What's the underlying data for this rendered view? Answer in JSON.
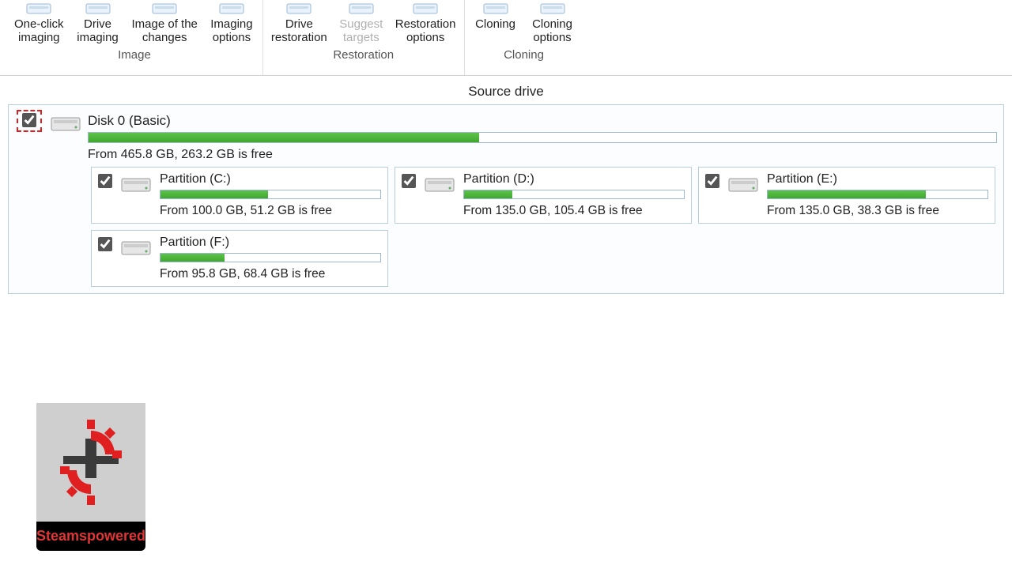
{
  "ribbon": {
    "groups": [
      {
        "label": "Image",
        "buttons": [
          {
            "id": "one-click-imaging",
            "line1": "One-click",
            "line2": "imaging"
          },
          {
            "id": "drive-imaging",
            "line1": "Drive",
            "line2": "imaging"
          },
          {
            "id": "image-of-changes",
            "line1": "Image of the",
            "line2": "changes"
          },
          {
            "id": "imaging-options",
            "line1": "Imaging",
            "line2": "options"
          }
        ]
      },
      {
        "label": "Restoration",
        "buttons": [
          {
            "id": "drive-restoration",
            "line1": "Drive",
            "line2": "restoration"
          },
          {
            "id": "suggest-targets",
            "line1": "Suggest",
            "line2": "targets",
            "disabled": true
          },
          {
            "id": "restoration-options",
            "line1": "Restoration",
            "line2": "options"
          }
        ]
      },
      {
        "label": "Cloning",
        "buttons": [
          {
            "id": "cloning",
            "line1": "Cloning",
            "line2": ""
          },
          {
            "id": "cloning-options",
            "line1": "Cloning",
            "line2": "options"
          }
        ]
      }
    ]
  },
  "panel": {
    "title": "Source drive",
    "disk": {
      "title": "Disk 0 (Basic)",
      "subtitle": "From 465.8 GB, 263.2 GB is free",
      "used_percent": 43
    },
    "partitions": [
      {
        "id": "C",
        "title": "Partition (C:)",
        "subtitle": "From 100.0 GB, 51.2 GB is free",
        "used_percent": 49
      },
      {
        "id": "D",
        "title": "Partition (D:)",
        "subtitle": "From 135.0 GB, 105.4 GB is free",
        "used_percent": 22
      },
      {
        "id": "E",
        "title": "Partition (E:)",
        "subtitle": "From 135.0 GB, 38.3 GB is free",
        "used_percent": 72
      },
      {
        "id": "F",
        "title": "Partition (F:)",
        "subtitle": "From 95.8 GB, 68.4 GB is free",
        "used_percent": 29
      }
    ]
  },
  "watermark": {
    "label": "Steamspowered"
  }
}
